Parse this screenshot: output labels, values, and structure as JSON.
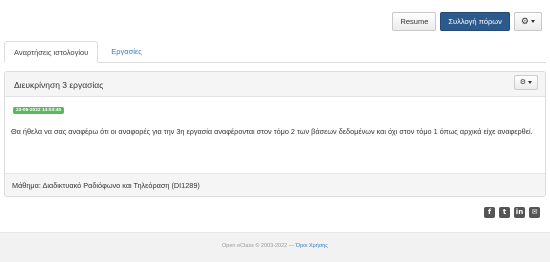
{
  "toolbar": {
    "resume_label": "Resume",
    "collect_label": "Συλλογή πόρων",
    "settings_icon": "gears-icon"
  },
  "tabs": [
    {
      "label": "Αναρτήσεις ιστολογίου",
      "active": true
    },
    {
      "label": "Εργασίες",
      "active": false
    }
  ],
  "post": {
    "title": "Διευκρίνηση 3 εργασίας",
    "timestamp": "23-05-2022 14:03:45",
    "message": "Θα ήθελα να σας αναφέρω ότι οι αναφορές για την  3η εργασία  αναφέρονται  στον τόμο 2 των βάσεων δεδομένων και όχι στον τόμο 1 όπως αρχικά είχε αναφερθεί.",
    "course": "Μάθημα: Διαδικτυακό Ραδιόφωνο και Τηλεόραση (DI1289)"
  },
  "social": [
    "facebook-icon",
    "twitter-icon",
    "linkedin-icon",
    "email-icon"
  ],
  "footer": {
    "copyright": "Open eClass © 2003-2022 — ",
    "terms_link": "Όροι Χρήσης"
  },
  "colors": {
    "primary": "#2d5a8c",
    "link": "#3a7bbf",
    "success": "#5cb85c"
  }
}
